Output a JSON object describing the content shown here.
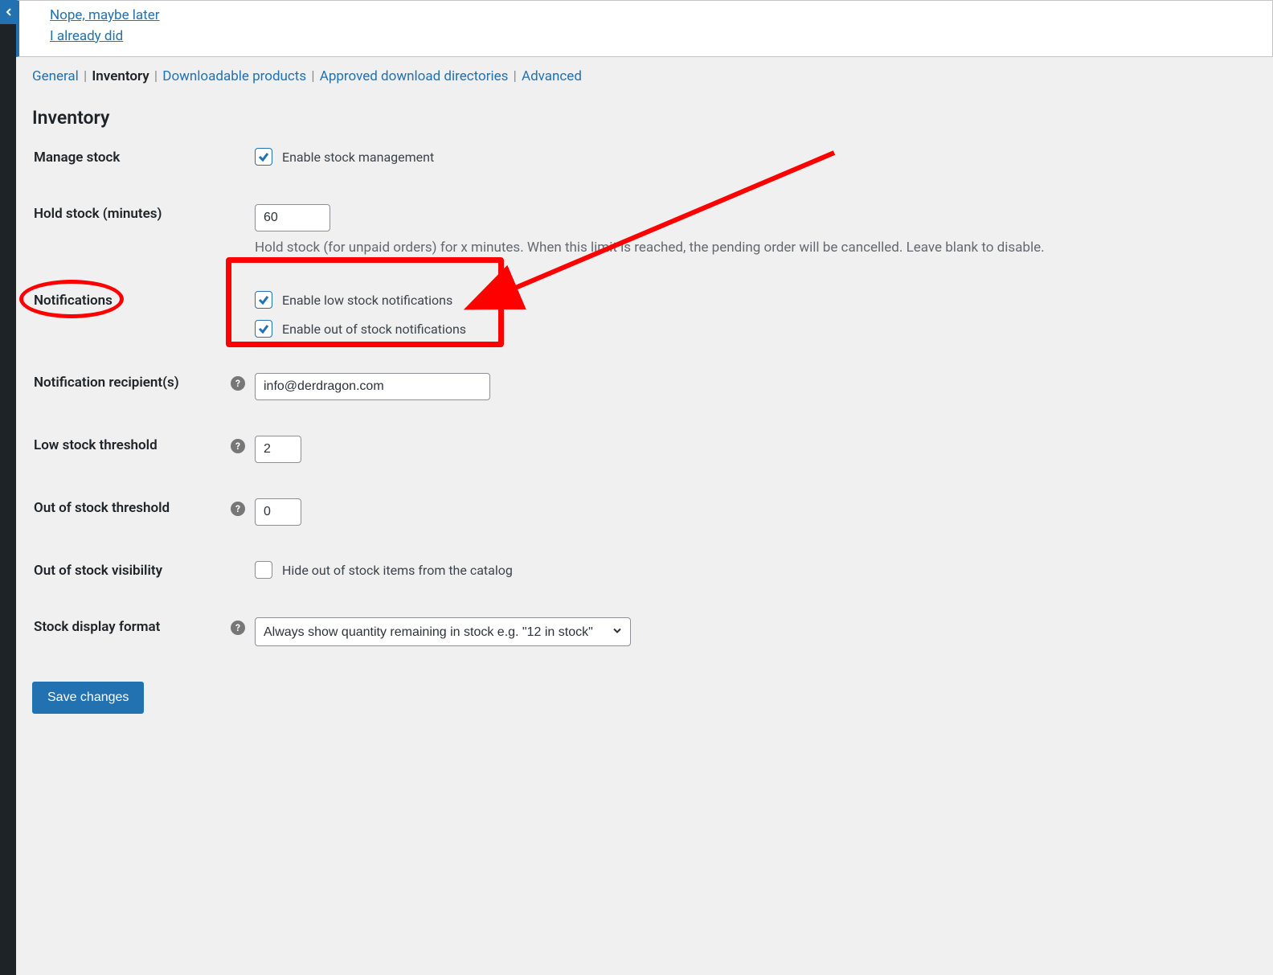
{
  "notice": {
    "later": "Nope, maybe later",
    "did": "I already did"
  },
  "subnav": {
    "general": "General",
    "inventory": "Inventory",
    "downloadable": "Downloadable products",
    "approved": "Approved download directories",
    "advanced": "Advanced"
  },
  "section_title": "Inventory",
  "rows": {
    "manage_stock": {
      "label": "Manage stock",
      "cb": "Enable stock management"
    },
    "hold_stock": {
      "label": "Hold stock (minutes)",
      "value": "60",
      "desc": "Hold stock (for unpaid orders) for x minutes. When this limit is reached, the pending order will be cancelled. Leave blank to disable."
    },
    "notifications": {
      "label": "Notifications",
      "cb1": "Enable low stock notifications",
      "cb2": "Enable out of stock notifications"
    },
    "recipient": {
      "label": "Notification recipient(s)",
      "value": "info@derdragon.com"
    },
    "low_threshold": {
      "label": "Low stock threshold",
      "value": "2"
    },
    "out_threshold": {
      "label": "Out of stock threshold",
      "value": "0"
    },
    "visibility": {
      "label": "Out of stock visibility",
      "cb": "Hide out of stock items from the catalog"
    },
    "display_format": {
      "label": "Stock display format",
      "value": "Always show quantity remaining in stock e.g. \"12 in stock\""
    }
  },
  "save_label": "Save changes"
}
